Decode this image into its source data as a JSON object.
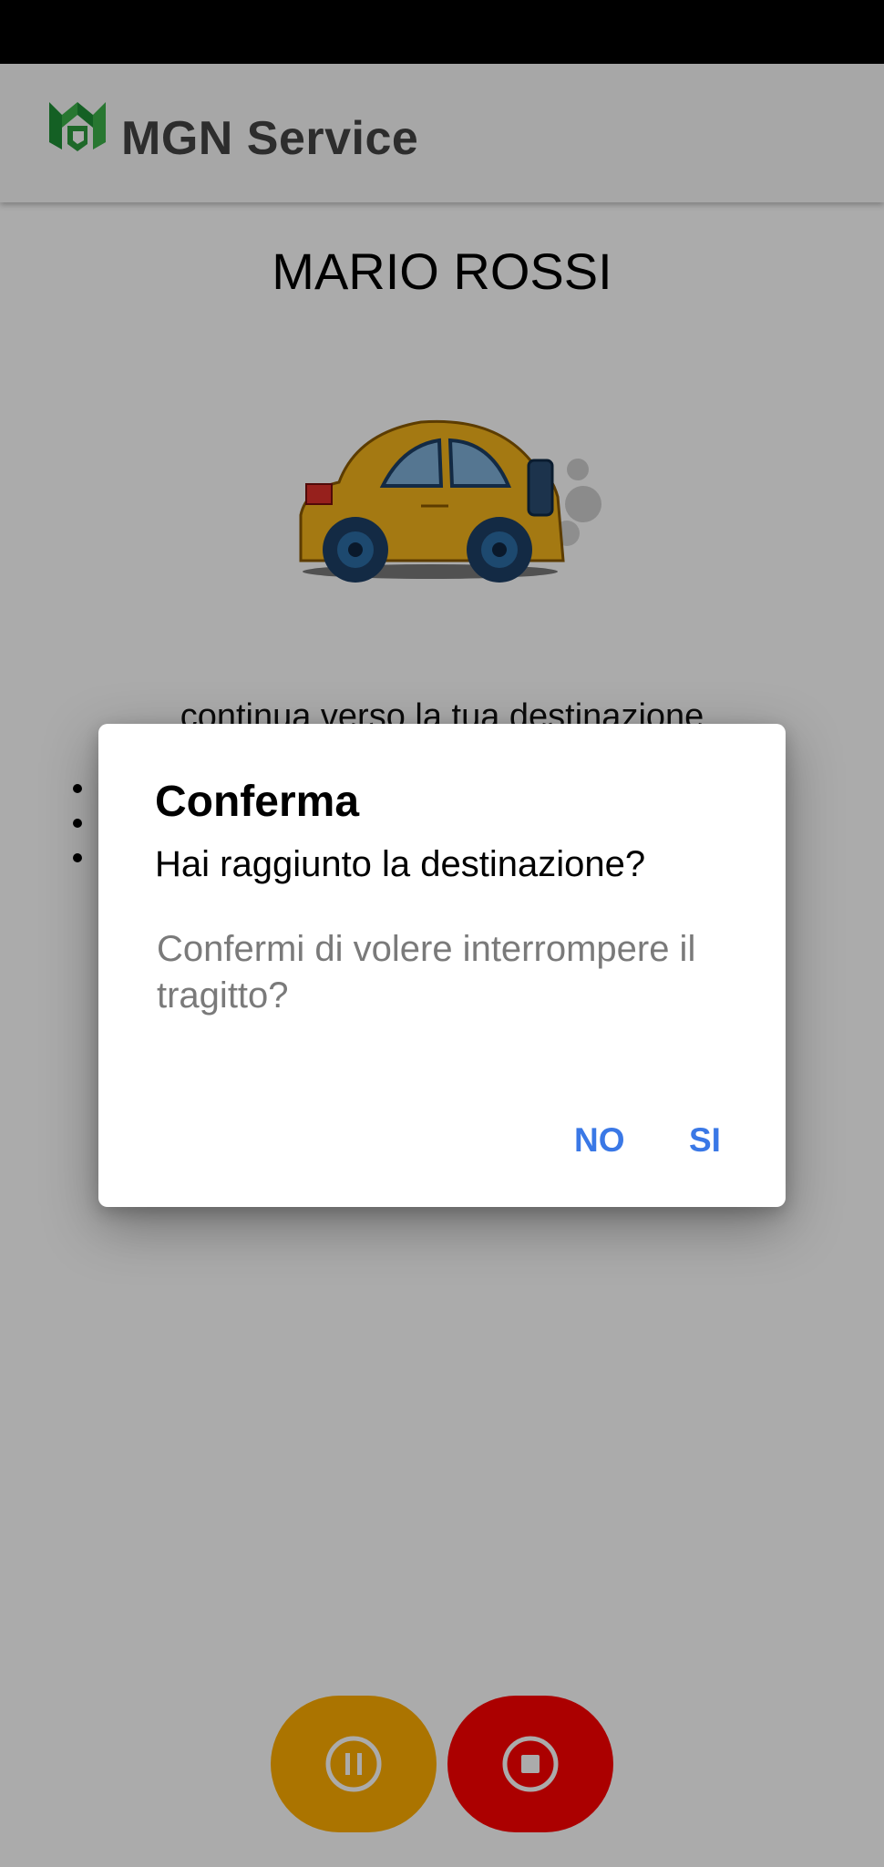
{
  "app": {
    "title": "MGN Service"
  },
  "main": {
    "user_name": "MARIO ROSSI",
    "instruction": "continua verso la tua destinazione"
  },
  "dialog": {
    "title": "Conferma",
    "subtitle": "Hai raggiunto la destinazione?",
    "message": "Confermi di volere interrompere il tragitto?",
    "no_label": "NO",
    "yes_label": "SI"
  },
  "icons": {
    "pause": "pause-icon",
    "stop": "stop-icon",
    "car": "car-illustration",
    "logo": "mgn-logo"
  },
  "colors": {
    "brand_green": "#2e9b3e",
    "accent_blue": "#3a78e6",
    "pause_button": "#ffae00",
    "stop_button": "#ff0000",
    "car_body": "#f5b51c"
  }
}
